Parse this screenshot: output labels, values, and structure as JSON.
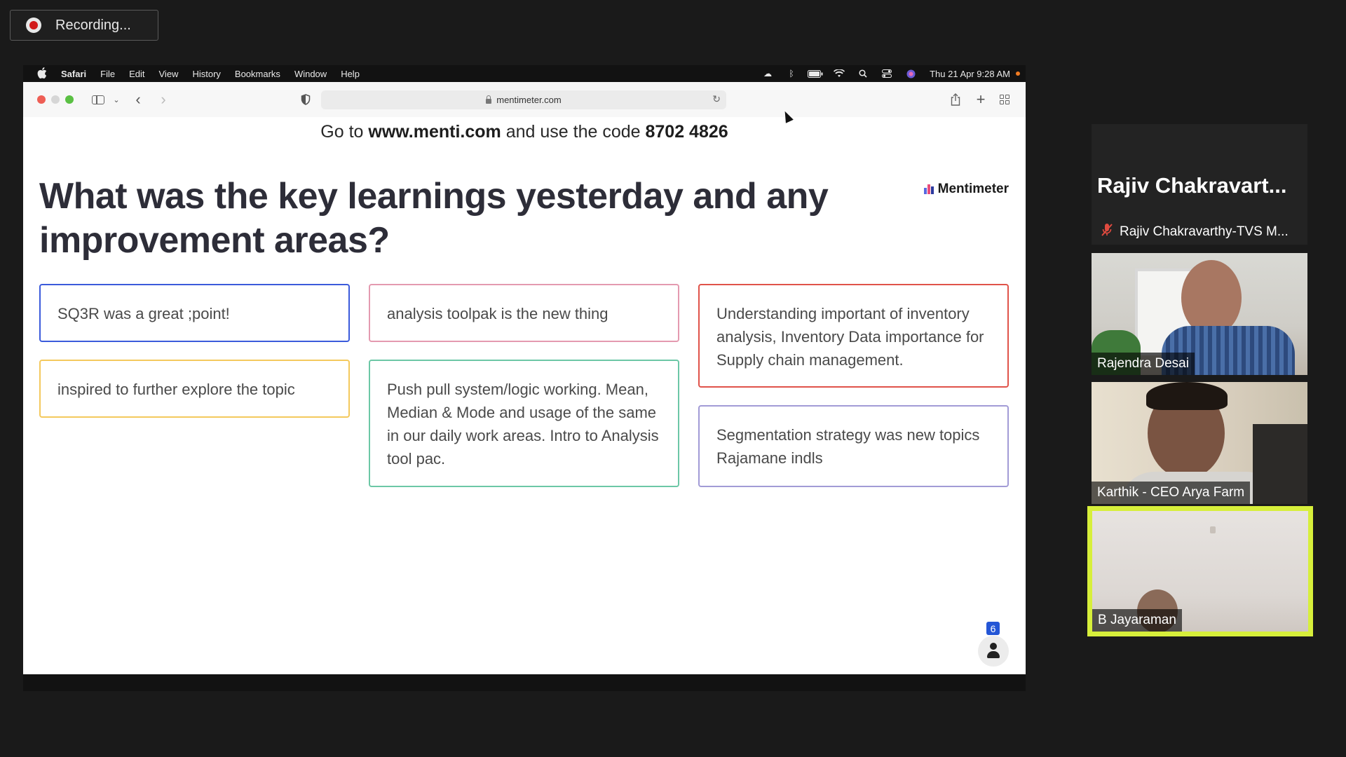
{
  "recording": {
    "label": "Recording..."
  },
  "menubar": {
    "app": "Safari",
    "items": [
      "File",
      "Edit",
      "View",
      "History",
      "Bookmarks",
      "Window",
      "Help"
    ],
    "clock": "Thu 21 Apr  9:28 AM"
  },
  "browser": {
    "url": "mentimeter.com"
  },
  "slide": {
    "join_prefix": "Go to ",
    "join_site": "www.menti.com",
    "join_mid": " and use the code ",
    "join_code": "8702 4826",
    "brand": "Mentimeter",
    "question": "What was the key learnings yesterday and any improvement areas?",
    "responses": [
      {
        "text": "SQ3R was a great ;point!",
        "color": "#3b5bdb"
      },
      {
        "text": "analysis toolpak is the new thing",
        "color": "#e49ab0"
      },
      {
        "text": "Understanding important of inventory analysis, Inventory Data importance for Supply chain management.",
        "color": "#e0534a"
      },
      {
        "text": "inspired to further explore the topic",
        "color": "#f4c95d"
      },
      {
        "text": "Push pull system/logic working. Mean, Median & Mode and usage of the same in our daily work areas. Intro to Analysis tool pac.",
        "color": "#6cc7a6"
      },
      {
        "text": "Segmentation strategy was new topics Rajamane indls",
        "color": "#a29bd6"
      }
    ],
    "participant_count": "6"
  },
  "participants": [
    {
      "display": "Rajiv  Chakravart...",
      "name": "Rajiv Chakravarthy-TVS M...",
      "muted": true
    },
    {
      "name": "Rajendra Desai"
    },
    {
      "name": "Karthik - CEO Arya Farm"
    },
    {
      "name": "B Jayaraman",
      "active_speaker": true
    }
  ],
  "colors": {
    "active_speaker_border": "#d7ef3b",
    "badge": "#2456d6"
  }
}
